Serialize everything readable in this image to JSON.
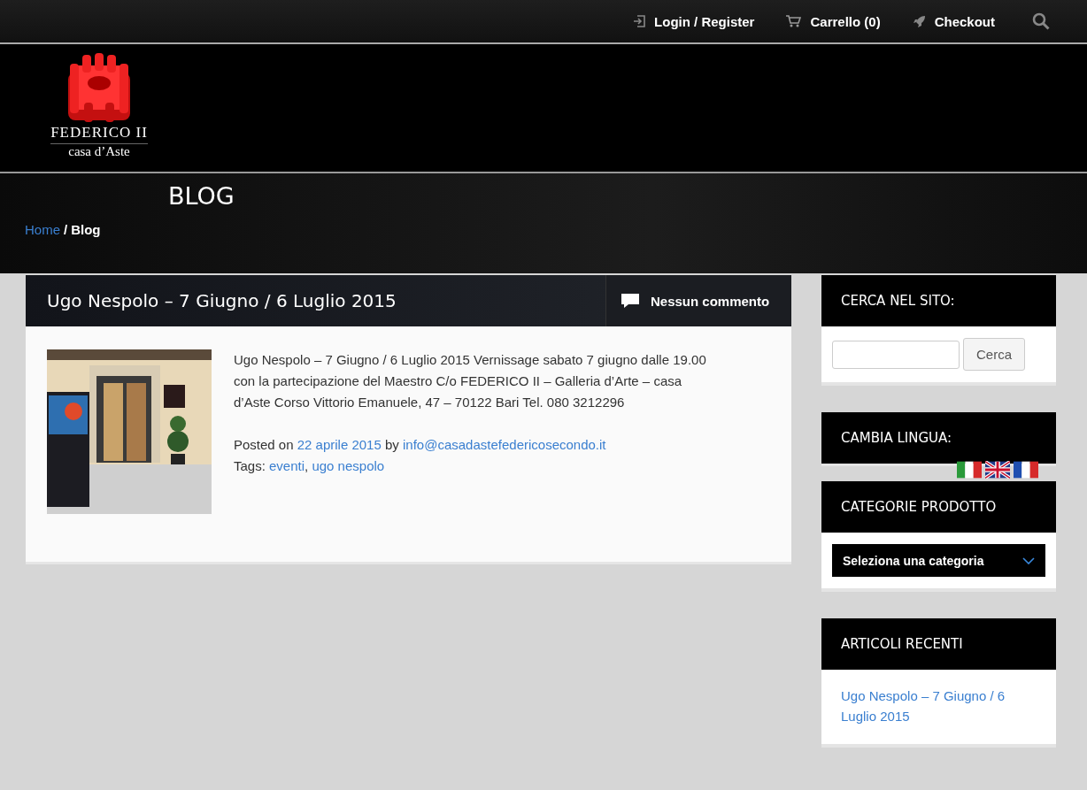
{
  "top_nav": [
    {
      "kind": "login",
      "label": "Login / Register"
    },
    {
      "kind": "cart",
      "label": "Carrello (0)"
    },
    {
      "kind": "checkout",
      "label": "Checkout"
    }
  ],
  "logo": {
    "name": "FEDERICO II",
    "subtitle": "casa d’Aste"
  },
  "page_header": {
    "title": "BLOG",
    "breadcrumb": [
      {
        "label": "Home",
        "link": true
      },
      {
        "label": "Blog",
        "link": false
      }
    ],
    "separator": "/"
  },
  "post": {
    "title": "Ugo Nespolo – 7 Giugno / 6 Luglio 2015",
    "comments": "Nessun commento",
    "image": {
      "kind": "picture"
    },
    "excerpt": "Ugo Nespolo  – 7 Giugno / 6 Luglio 2015 Vernissage sabato 7 giugno dalle 19.00 con la partecipazione del Maestro C/o FEDERICO II – Galleria d’Arte – casa d’Aste Corso Vittorio Emanuele, 47 – 70122 Bari Tel. 080 3212296",
    "posted_on": "Posted on",
    "date": "22 aprile 2015",
    "by": "by",
    "author": "info@casadastefedericosecondo.it",
    "tags_label": "Tags:",
    "tags": [
      "eventi",
      "ugo nespolo"
    ],
    "tag_separator": ","
  },
  "sidebar": [
    {
      "kind": "search",
      "title": "CERCA NEL SITO:",
      "button": "Cerca"
    },
    {
      "kind": "language",
      "title": "CAMBIA LINGUA:",
      "flags": [
        {
          "kind": "it"
        },
        {
          "kind": "uk"
        },
        {
          "kind": "fr"
        }
      ]
    },
    {
      "kind": "category",
      "title": "CATEGORIE PRODOTTO",
      "select": "Seleziona una categoria"
    },
    {
      "kind": "recent",
      "title": "ARTICOLI RECENTI",
      "links": [
        "Ugo Nespolo – 7 Giugno / 6 Luglio 2015"
      ]
    }
  ]
}
